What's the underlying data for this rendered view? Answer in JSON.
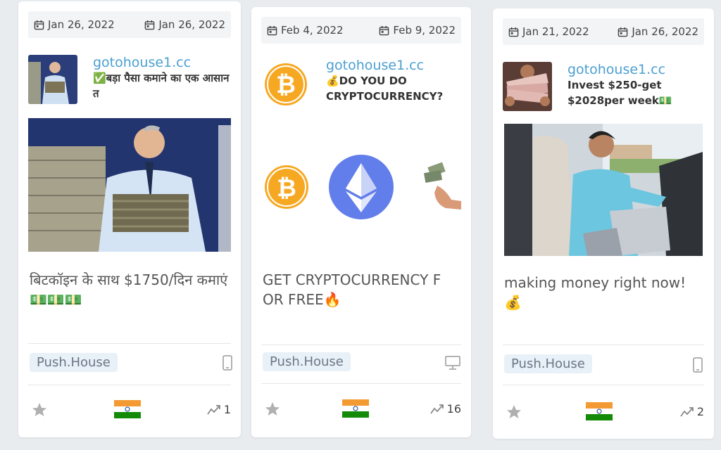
{
  "cards": [
    {
      "date_start": "Jan 26, 2022",
      "date_end": "Jan 26, 2022",
      "domain": "gotohouse1.cc",
      "title": "✅बड़ा पैसा कमाने का एक आसान त",
      "description": "बिटकॉइन के साथ $1750/दिन कमाएं 💵💵💵",
      "network": "Push.House",
      "device": "mobile-icon",
      "country": "India",
      "clicks": "1"
    },
    {
      "date_start": "Feb 4, 2022",
      "date_end": "Feb 9, 2022",
      "domain": "gotohouse1.cc",
      "title": "💰DO YOU DO CRYPTOCURRENCY?",
      "description": "GET CRYPTOCURRENCY F OR FREE🔥",
      "network": "Push.House",
      "device": "desktop-icon",
      "country": "India",
      "clicks": "16"
    },
    {
      "date_start": "Jan 21, 2022",
      "date_end": "Jan 26, 2022",
      "domain": "gotohouse1.cc",
      "title": "Invest $250-get $2028per week💵",
      "description": "making money right now! 💰",
      "network": "Push.House",
      "device": "mobile-icon",
      "country": "India",
      "clicks": "2"
    }
  ],
  "colors": {
    "domain": "#4a9fd1",
    "tag_bg": "#e8f0f8",
    "bitcoin": "#f7a823",
    "ethereum": "#627eea"
  }
}
